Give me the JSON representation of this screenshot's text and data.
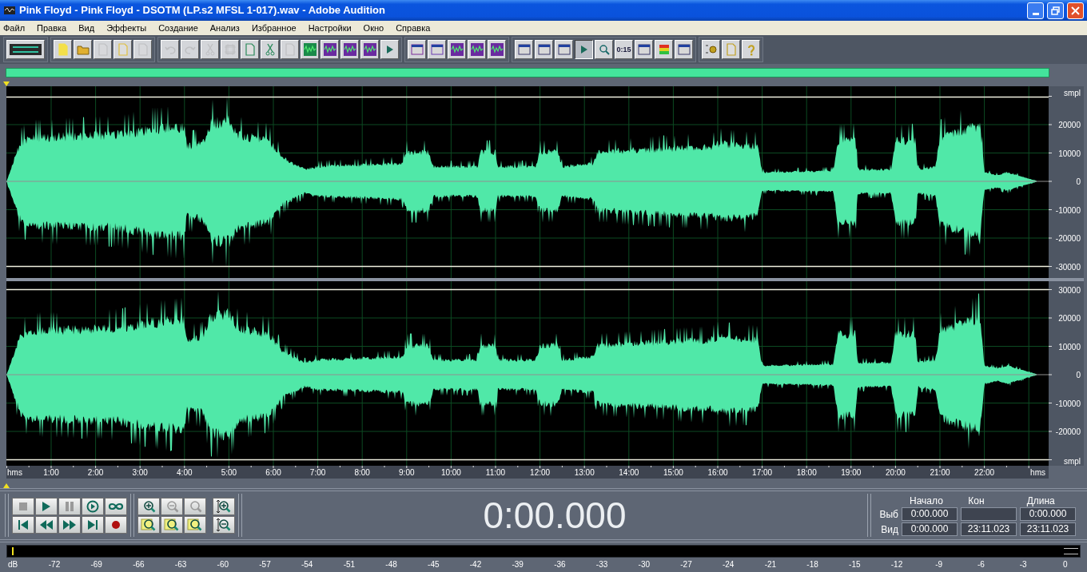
{
  "window": {
    "title": "Pink Floyd - Pink Floyd - DSOTM (LP.s2 MFSL 1-017).wav - Adobe Audition"
  },
  "menu": [
    "Файл",
    "Правка",
    "Вид",
    "Эффекты",
    "Создание",
    "Анализ",
    "Избранное",
    "Настройки",
    "Окно",
    "Справка"
  ],
  "toolbar": [
    [
      {
        "kind": "multitrack",
        "disabled": false,
        "pressed": false
      }
    ],
    [
      {
        "kind": "new",
        "disabled": false,
        "pressed": false
      },
      {
        "kind": "open",
        "disabled": false,
        "pressed": false
      },
      {
        "kind": "save",
        "disabled": true,
        "pressed": false
      },
      {
        "kind": "saveas",
        "disabled": false,
        "pressed": false
      },
      {
        "kind": "saveall",
        "disabled": true,
        "pressed": false
      }
    ],
    [
      {
        "kind": "undo",
        "disabled": true,
        "pressed": false
      },
      {
        "kind": "redo",
        "disabled": true,
        "pressed": false
      },
      {
        "kind": "trim",
        "disabled": true,
        "pressed": false
      },
      {
        "kind": "crop",
        "disabled": true,
        "pressed": false
      },
      {
        "kind": "copy",
        "disabled": false,
        "pressed": false
      },
      {
        "kind": "cut",
        "disabled": false,
        "pressed": false
      },
      {
        "kind": "paste",
        "disabled": true,
        "pressed": false
      },
      {
        "kind": "mix",
        "disabled": false,
        "pressed": false
      },
      {
        "kind": "wave",
        "disabled": false,
        "pressed": false
      },
      {
        "kind": "wave",
        "disabled": false,
        "pressed": false
      },
      {
        "kind": "wave",
        "disabled": false,
        "pressed": false
      },
      {
        "kind": "play",
        "disabled": false,
        "pressed": false
      }
    ],
    [
      {
        "kind": "view",
        "disabled": false,
        "pressed": false
      },
      {
        "kind": "check",
        "disabled": false,
        "pressed": false
      },
      {
        "kind": "wave",
        "disabled": false,
        "pressed": false
      },
      {
        "kind": "wave",
        "disabled": false,
        "pressed": false
      },
      {
        "kind": "wave",
        "disabled": false,
        "pressed": false
      }
    ],
    [
      {
        "kind": "window",
        "disabled": false,
        "pressed": false
      },
      {
        "kind": "window",
        "disabled": false,
        "pressed": false
      },
      {
        "kind": "window",
        "disabled": false,
        "pressed": false
      },
      {
        "kind": "play",
        "disabled": false,
        "pressed": true
      },
      {
        "kind": "zoom",
        "disabled": false,
        "pressed": false
      },
      {
        "kind": "text",
        "label": "0:15",
        "disabled": false,
        "pressed": false
      },
      {
        "kind": "window",
        "disabled": false,
        "pressed": false
      },
      {
        "kind": "meter",
        "disabled": false,
        "pressed": false
      },
      {
        "kind": "window",
        "disabled": false,
        "pressed": false
      }
    ],
    [
      {
        "kind": "settings",
        "disabled": false,
        "pressed": false
      },
      {
        "kind": "script",
        "disabled": false,
        "pressed": false
      },
      {
        "kind": "help",
        "disabled": false,
        "pressed": false
      }
    ]
  ],
  "channels": [
    {
      "labels": [
        "smpl",
        "20000",
        "10000",
        "0",
        "-10000",
        "-20000",
        "-30000"
      ]
    },
    {
      "labels": [
        "30000",
        "20000",
        "10000",
        "0",
        "-10000",
        "-20000",
        "smpl"
      ]
    }
  ],
  "time_ruler": [
    "hms",
    "1:00",
    "2:00",
    "3:00",
    "4:00",
    "5:00",
    "6:00",
    "7:00",
    "8:00",
    "9:00",
    "10:00",
    "11:00",
    "12:00",
    "13:00",
    "14:00",
    "15:00",
    "16:00",
    "17:00",
    "18:00",
    "19:00",
    "20:00",
    "21:00",
    "22:00",
    "hms"
  ],
  "transport": [
    {
      "kind": "stop",
      "disabled": true
    },
    {
      "kind": "play",
      "disabled": false
    },
    {
      "kind": "pause",
      "disabled": true
    },
    {
      "kind": "playloop",
      "disabled": false
    },
    {
      "kind": "loop",
      "disabled": false
    },
    {
      "kind": "start",
      "disabled": false
    },
    {
      "kind": "rewind",
      "disabled": false
    },
    {
      "kind": "forward",
      "disabled": false
    },
    {
      "kind": "end",
      "disabled": false
    },
    {
      "kind": "record",
      "disabled": false
    }
  ],
  "zoom": [
    {
      "kind": "zoomin",
      "disabled": false
    },
    {
      "kind": "zoomout",
      "disabled": true
    },
    {
      "kind": "zoomfull",
      "disabled": true
    },
    {
      "kind": "zoomleft",
      "disabled": false
    },
    {
      "kind": "zoomright",
      "disabled": false
    },
    {
      "kind": "zoomsel",
      "disabled": false
    }
  ],
  "vzoom": [
    {
      "kind": "vzoomin",
      "disabled": false
    },
    {
      "kind": "vzoomout",
      "disabled": false
    }
  ],
  "time_display": "0:00.000",
  "selection": {
    "headers": [
      "Начало",
      "Кон",
      "Длина"
    ],
    "rows": [
      {
        "label": "Выб",
        "start": "0:00.000",
        "length": "0:00.000"
      },
      {
        "label": "Вид",
        "start": "0:00.000",
        "end": "23:11.023",
        "length": "23:11.023"
      }
    ]
  },
  "meter": {
    "labels": [
      "dB",
      "-72",
      "-69",
      "-66",
      "-63",
      "-60",
      "-57",
      "-54",
      "-51",
      "-48",
      "-45",
      "-42",
      "-39",
      "-36",
      "-33",
      "-30",
      "-27",
      "-24",
      "-21",
      "-18",
      "-15",
      "-12",
      "-9",
      "-6",
      "-3",
      "0"
    ]
  }
}
